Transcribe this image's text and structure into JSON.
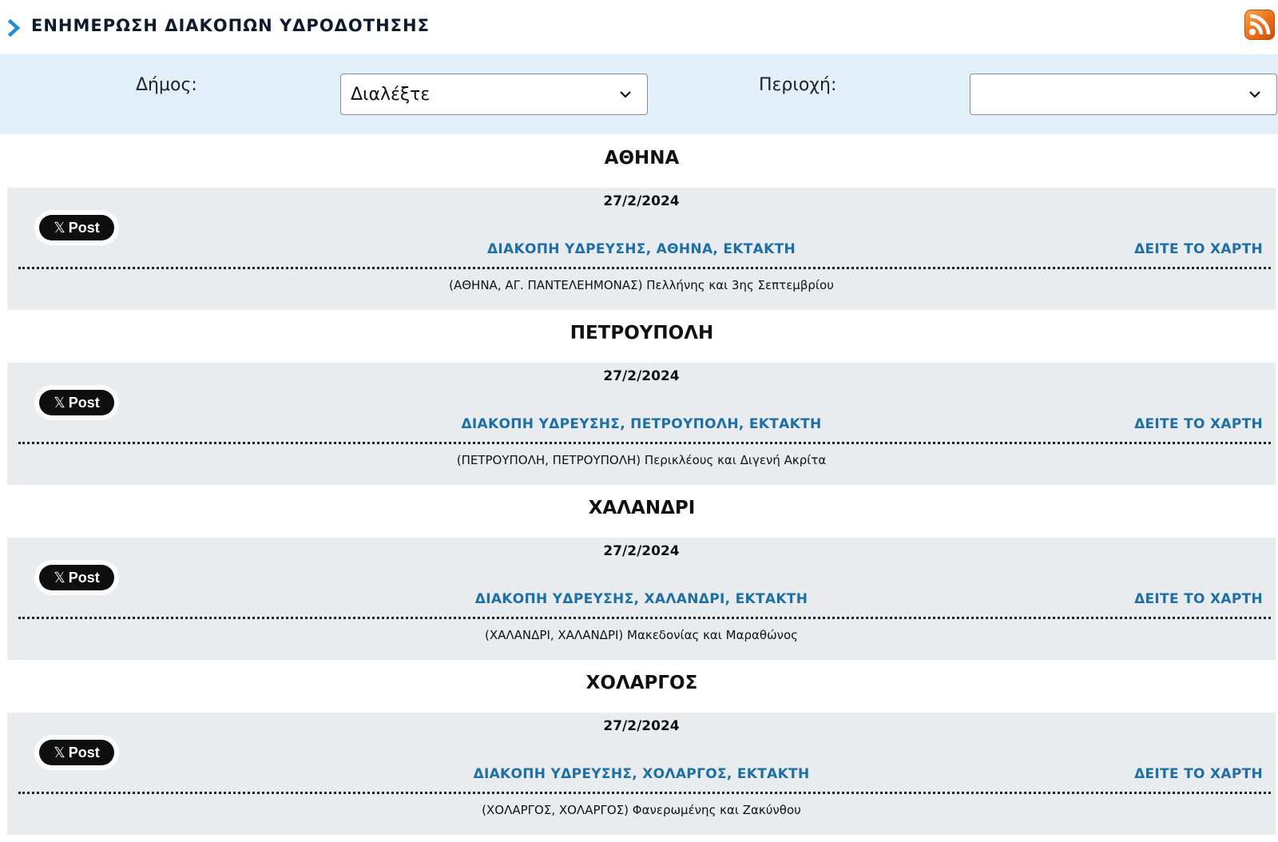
{
  "header": {
    "title": "ΕΝΗΜΕΡΩΣΗ ΔΙΑΚΟΠΩΝ ΥΔΡΟΔΟΤΗΣΗΣ",
    "rss_icon": "rss-feed-icon",
    "rss_color": "#ea6b17"
  },
  "filters": {
    "municipality_label": "Δήμος:",
    "municipality_value": "Διαλέξτε",
    "area_label": "Περιοχή:",
    "area_value": ""
  },
  "colors": {
    "link": "#1e6fa6",
    "filter_bg": "#e1eff9",
    "card_bg": "#e8ecef"
  },
  "sections": [
    {
      "title": "ΑΘΗΝΑ",
      "date": "27/2/2024",
      "post_label": "Post",
      "link": "ΔΙΑΚΟΠΗ ΥΔΡΕΥΣΗΣ, ΑΘΗΝΑ, ΕΚΤΑΚΤΗ",
      "map_link": "ΔΕΙΤΕ ΤΟ ΧΑΡΤΗ",
      "detail": "(ΑΘΗΝΑ, ΑΓ. ΠΑΝΤΕΛΕΗΜΟΝΑΣ) Πελλήνης και 3ης Σεπτεμβρίου"
    },
    {
      "title": "ΠΕΤΡΟΥΠΟΛΗ",
      "date": "27/2/2024",
      "post_label": "Post",
      "link": "ΔΙΑΚΟΠΗ ΥΔΡΕΥΣΗΣ, ΠΕΤΡΟΥΠΟΛΗ, ΕΚΤΑΚΤΗ",
      "map_link": "ΔΕΙΤΕ ΤΟ ΧΑΡΤΗ",
      "detail": "(ΠΕΤΡΟΥΠΟΛΗ, ΠΕΤΡΟΥΠΟΛΗ) Περικλέους και Διγενή Ακρίτα"
    },
    {
      "title": "ΧΑΛΑΝΔΡΙ",
      "date": "27/2/2024",
      "post_label": "Post",
      "link": "ΔΙΑΚΟΠΗ ΥΔΡΕΥΣΗΣ, ΧΑΛΑΝΔΡΙ, ΕΚΤΑΚΤΗ",
      "map_link": "ΔΕΙΤΕ ΤΟ ΧΑΡΤΗ",
      "detail": "(ΧΑΛΑΝΔΡΙ, ΧΑΛΑΝΔΡΙ) Μακεδονίας και Μαραθώνος"
    },
    {
      "title": "ΧΟΛΑΡΓΟΣ",
      "date": "27/2/2024",
      "post_label": "Post",
      "link": "ΔΙΑΚΟΠΗ ΥΔΡΕΥΣΗΣ, ΧΟΛΑΡΓΟΣ, ΕΚΤΑΚΤΗ",
      "map_link": "ΔΕΙΤΕ ΤΟ ΧΑΡΤΗ",
      "detail": "(ΧΟΛΑΡΓΟΣ, ΧΟΛΑΡΓΟΣ) Φανερωμένης και Ζακύνθου"
    }
  ]
}
